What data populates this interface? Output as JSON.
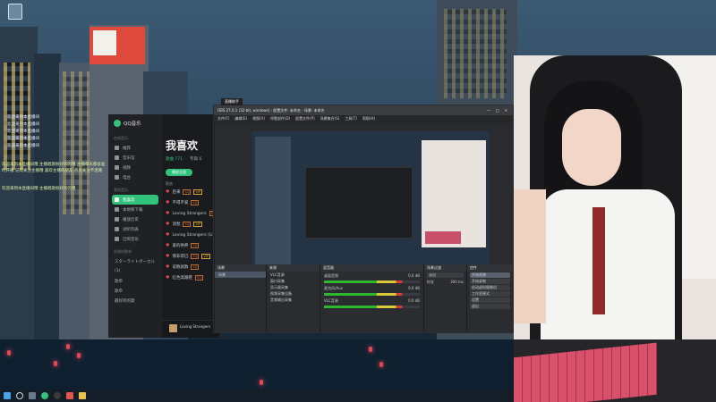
{
  "desktop": {
    "icons": [
      {
        "name": "recycle-bin"
      }
    ]
  },
  "chat_overlay": {
    "rows": [
      {
        "badge": "",
        "text": "欢迎来到本直播间"
      },
      {
        "badge": "",
        "text": "欢迎来到本直播间"
      },
      {
        "badge": "",
        "text": "欢迎来到本直播间"
      },
      {
        "badge": "",
        "text": "欢迎来到本直播间"
      },
      {
        "badge": "",
        "text": "欢迎来到本直播间"
      }
    ],
    "notice": "欢迎来到本直播间哦 主播唱歌很好听的哦 主播每天都会准时开播 记得关注主播哦 喜欢主播的朋友 点点关注不迷路",
    "notice2": "欢迎来到本直播间哦 主播唱歌很好听的哦"
  },
  "qqmusic": {
    "app_name": "QQ音乐",
    "sidebar": {
      "section_online": "在线音乐",
      "online_items": [
        "推荐",
        "音乐馆",
        "视频",
        "电台"
      ],
      "section_mine": "我的音乐",
      "mine_items": [
        "我喜欢",
        "本地和下载",
        "播放历史",
        "试听列表",
        "已购音乐"
      ],
      "section_created": "创建的歌单",
      "created_items": [
        "スターライトボーカル",
        "(1)",
        "歌单",
        "歌单",
        "最好听的歌"
      ]
    },
    "main": {
      "title": "我喜欢",
      "tabs": [
        "歌曲 771",
        "专辑 6"
      ],
      "play_all": "播放全部",
      "list_label": "歌曲",
      "songs": [
        {
          "title": "后来",
          "tags": [
            "SQ",
            "VIP"
          ]
        },
        {
          "title": "不得不爱",
          "tags": [
            "SQ"
          ]
        },
        {
          "title": "Loving Strangers",
          "tags": [
            "SQ"
          ]
        },
        {
          "title": "消愁",
          "tags": [
            "SQ",
            "VIP"
          ]
        },
        {
          "title": "Loving Strangers (Live)",
          "tags": []
        },
        {
          "title": "爱的供养",
          "tags": [
            "SQ"
          ]
        },
        {
          "title": "情非得已",
          "tags": [
            "SQ",
            "VIP"
          ]
        },
        {
          "title": "说散就散",
          "tags": [
            "SQ"
          ]
        },
        {
          "title": "红色高跟鞋",
          "tags": [
            "SQ"
          ]
        }
      ]
    },
    "player": {
      "now_playing": "Loving Strangers"
    }
  },
  "obs": {
    "title": "OBS 27.0.1 (32-bit, windows) - 配置文件: 未命名 - 场景: 未命名",
    "header_badge": "直播助手",
    "window_controls": [
      "—",
      "□",
      "✕"
    ],
    "menu": [
      "文件(F)",
      "编辑(E)",
      "视图(V)",
      "停靠部件(D)",
      "配置文件(P)",
      "场景集合(S)",
      "工具(T)",
      "帮助(H)"
    ],
    "docks": {
      "scenes": {
        "header": "场景",
        "items": [
          "场景"
        ]
      },
      "sources": {
        "header": "来源",
        "items": [
          "VLC音源",
          "窗口采集",
          "显示器采集",
          "视频采集设备",
          "音频输出采集"
        ]
      },
      "mixer": {
        "header": "混音器",
        "channels": [
          {
            "name": "桌面音频",
            "level": "0.0 dB"
          },
          {
            "name": "麦克风/Aux",
            "level": "0.0 dB"
          },
          {
            "name": "VLC音源",
            "level": "0.0 dB"
          }
        ]
      },
      "transitions": {
        "header": "场景过渡",
        "type": "淡出",
        "duration_label": "时长",
        "duration": "300 ms"
      },
      "controls": {
        "header": "控件",
        "buttons": [
          "开始直播",
          "开始录制",
          "启动虚拟摄像机",
          "工作室模式",
          "设置",
          "退出"
        ]
      }
    }
  },
  "taskbar": {
    "items": [
      "start-button",
      "search-button",
      "task-view",
      "qqmusic",
      "obs",
      "browser",
      "folder"
    ]
  }
}
